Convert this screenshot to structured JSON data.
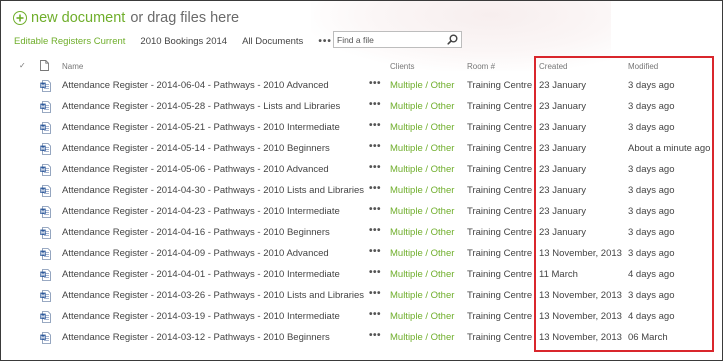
{
  "toolbar": {
    "new_document_label": "new document",
    "drag_text": "or drag files here"
  },
  "views": {
    "tabs": [
      {
        "label": "Editable Registers Current",
        "active": true
      },
      {
        "label": "2010 Bookings 2014",
        "active": false
      },
      {
        "label": "All Documents",
        "active": false
      }
    ],
    "more_label": "•••"
  },
  "search": {
    "placeholder": "Find a file",
    "value": ""
  },
  "columns": {
    "check": "✓",
    "name": "Name",
    "clients": "Clients",
    "room": "Room #",
    "created": "Created",
    "modified": "Modified"
  },
  "icons": {
    "new_document": "plus-circle-icon",
    "document": "word-document-icon",
    "search": "magnifier-icon",
    "row_menu": "ellipsis-icon"
  },
  "colors": {
    "accent": "#6fae2b",
    "highlight_border": "#d9262c",
    "doc_icon": "#2b579a"
  },
  "row_menu_label": "•••",
  "rows": [
    {
      "name": "Attendance Register - 2014-06-04 - Pathways - 2010 Advanced",
      "clients": "Multiple / Other",
      "room": "Training Centre",
      "created": "23 January",
      "modified": "3 days ago"
    },
    {
      "name": "Attendance Register - 2014-05-28 - Pathways - Lists and Libraries",
      "clients": "Multiple / Other",
      "room": "Training Centre",
      "created": "23 January",
      "modified": "3 days ago"
    },
    {
      "name": "Attendance Register - 2014-05-21 - Pathways - 2010 Intermediate",
      "clients": "Multiple / Other",
      "room": "Training Centre",
      "created": "23 January",
      "modified": "3 days ago"
    },
    {
      "name": "Attendance Register - 2014-05-14 - Pathways - 2010 Beginners",
      "clients": "Multiple / Other",
      "room": "Training Centre",
      "created": "23 January",
      "modified": "About a minute ago"
    },
    {
      "name": "Attendance Register - 2014-05-06 - Pathways - 2010 Advanced",
      "clients": "Multiple / Other",
      "room": "Training Centre",
      "created": "23 January",
      "modified": "3 days ago"
    },
    {
      "name": "Attendance Register - 2014-04-30 - Pathways - 2010 Lists and Libraries",
      "clients": "Multiple / Other",
      "room": "Training Centre",
      "created": "23 January",
      "modified": "3 days ago"
    },
    {
      "name": "Attendance Register - 2014-04-23 - Pathways - 2010 Intermediate",
      "clients": "Multiple / Other",
      "room": "Training Centre",
      "created": "23 January",
      "modified": "3 days ago"
    },
    {
      "name": "Attendance Register - 2014-04-16 - Pathways - 2010 Beginners",
      "clients": "Multiple / Other",
      "room": "Training Centre",
      "created": "23 January",
      "modified": "3 days ago"
    },
    {
      "name": "Attendance Register - 2014-04-09 - Pathways - 2010 Advanced",
      "clients": "Multiple / Other",
      "room": "Training Centre",
      "created": "13 November, 2013",
      "modified": "3 days ago"
    },
    {
      "name": "Attendance Register - 2014-04-01 - Pathways - 2010 Intermediate",
      "clients": "Multiple / Other",
      "room": "Training Centre",
      "created": "11 March",
      "modified": "4 days ago"
    },
    {
      "name": "Attendance Register - 2014-03-26 - Pathways - 2010 Lists and Libraries",
      "clients": "Multiple / Other",
      "room": "Training Centre",
      "created": "13 November, 2013",
      "modified": "3 days ago"
    },
    {
      "name": "Attendance Register - 2014-03-19 - Pathways - 2010 Intermediate",
      "clients": "Multiple / Other",
      "room": "Training Centre",
      "created": "13 November, 2013",
      "modified": "4 days ago"
    },
    {
      "name": "Attendance Register - 2014-03-12 - Pathways - 2010 Beginners",
      "clients": "Multiple / Other",
      "room": "Training Centre",
      "created": "13 November, 2013",
      "modified": "06 March"
    }
  ]
}
